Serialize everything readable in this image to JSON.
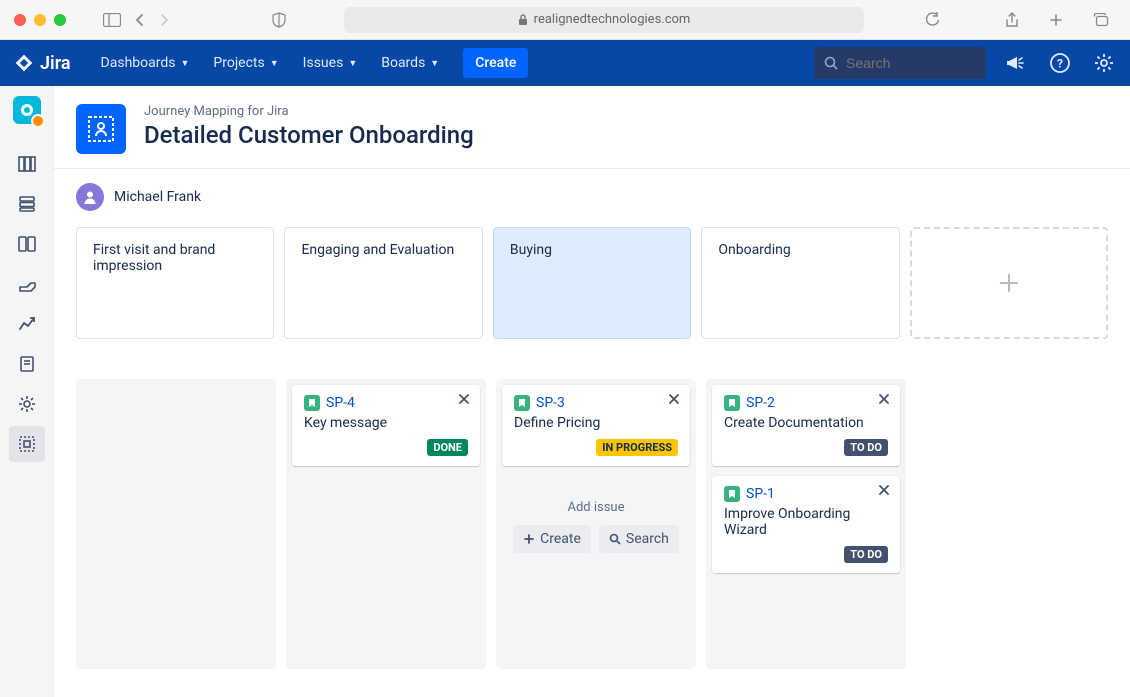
{
  "browser": {
    "url": "realignedtechnologies.com"
  },
  "topnav": {
    "logo_text": "Jira",
    "menus": [
      "Dashboards",
      "Projects",
      "Issues",
      "Boards"
    ],
    "create_label": "Create",
    "search_placeholder": "Search"
  },
  "header": {
    "breadcrumb": "Journey Mapping for Jira",
    "title": "Detailed Customer Onboarding"
  },
  "user": {
    "name": "Michael Frank"
  },
  "stages": [
    {
      "label": "First visit and brand impression",
      "selected": false
    },
    {
      "label": "Engaging and Evaluation",
      "selected": false
    },
    {
      "label": "Buying",
      "selected": true
    },
    {
      "label": "Onboarding",
      "selected": false
    }
  ],
  "columns": [
    {
      "issues": []
    },
    {
      "issues": [
        {
          "key": "SP-4",
          "summary": "Key message",
          "status": "DONE",
          "status_class": "lz-done"
        }
      ]
    },
    {
      "issues": [
        {
          "key": "SP-3",
          "summary": "Define Pricing",
          "status": "IN PROGRESS",
          "status_class": "lz-progress"
        }
      ],
      "add": {
        "label": "Add issue",
        "create": "Create",
        "search": "Search"
      }
    },
    {
      "issues": [
        {
          "key": "SP-2",
          "summary": "Create Documentation",
          "status": "TO DO",
          "status_class": "lz-todo"
        },
        {
          "key": "SP-1",
          "summary": "Improve Onboarding Wizard",
          "status": "TO DO",
          "status_class": "lz-todo"
        }
      ]
    }
  ]
}
